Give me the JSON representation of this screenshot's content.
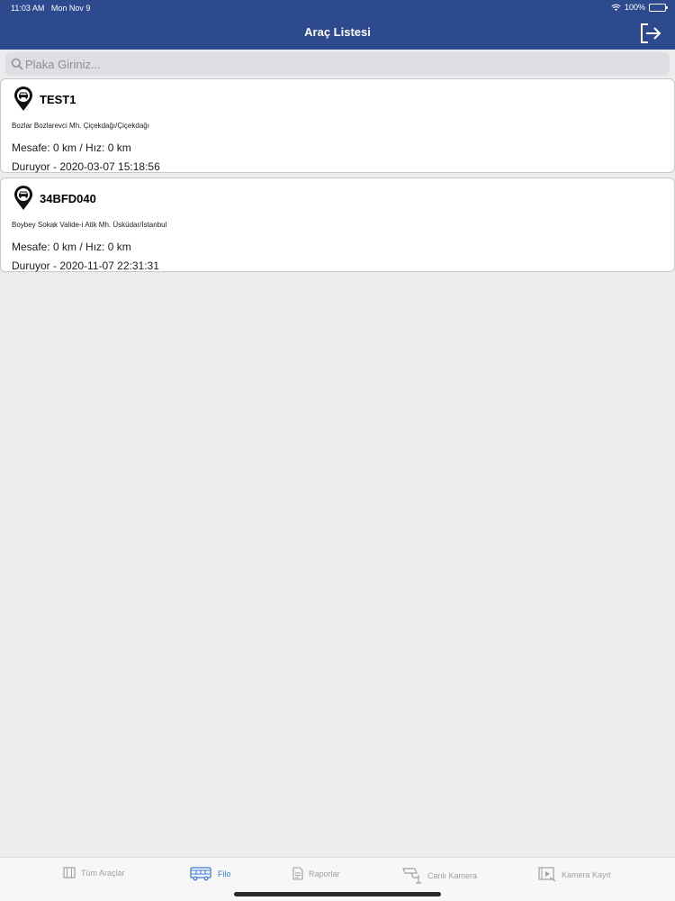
{
  "status_bar": {
    "time": "11:03 AM",
    "date": "Mon Nov 9",
    "battery": "100%",
    "battery_level": 1.0,
    "wifi_icon": "wifi-icon",
    "battery_icon": "battery-icon"
  },
  "nav": {
    "title": "Araç Listesi",
    "logout_icon": "logout-icon"
  },
  "search": {
    "placeholder": "Plaka Giriniz...",
    "value": "",
    "icon": "search-icon"
  },
  "vehicles": [
    {
      "plate": "TEST1",
      "address": "Bozlar Bozlarevci Mh. Çiçekdağı/Çiçekdağı",
      "metrics": "Mesafe: 0 km / Hız: 0 km",
      "status": "Duruyor - 2020-03-07 15:18:56",
      "icon": "car-pin-icon"
    },
    {
      "plate": "34BFD040",
      "address": "Boybey Sokak Valide-i Atik Mh. Üsküdar/İstanbul",
      "metrics": "Mesafe: 0 km / Hız: 0 km",
      "status": "Duruyor - 2020-11-07 22:31:31",
      "icon": "car-pin-icon"
    }
  ],
  "tabs": [
    {
      "label": "Tüm Araçlar",
      "icon": "all-vehicles-icon",
      "active": false
    },
    {
      "label": "Filo",
      "icon": "bus-icon",
      "active": true
    },
    {
      "label": "Raporlar",
      "icon": "document-icon",
      "active": false
    },
    {
      "label": "Canlı Kamera",
      "icon": "security-camera-icon",
      "active": false
    },
    {
      "label": "Kamera Kayıt",
      "icon": "video-record-icon",
      "active": false
    }
  ],
  "colors": {
    "nav_background": "#2d4a8e",
    "active_tab": "#3a7bd5",
    "inactive_tab": "#a0a0a5",
    "page_background": "#ececee"
  }
}
